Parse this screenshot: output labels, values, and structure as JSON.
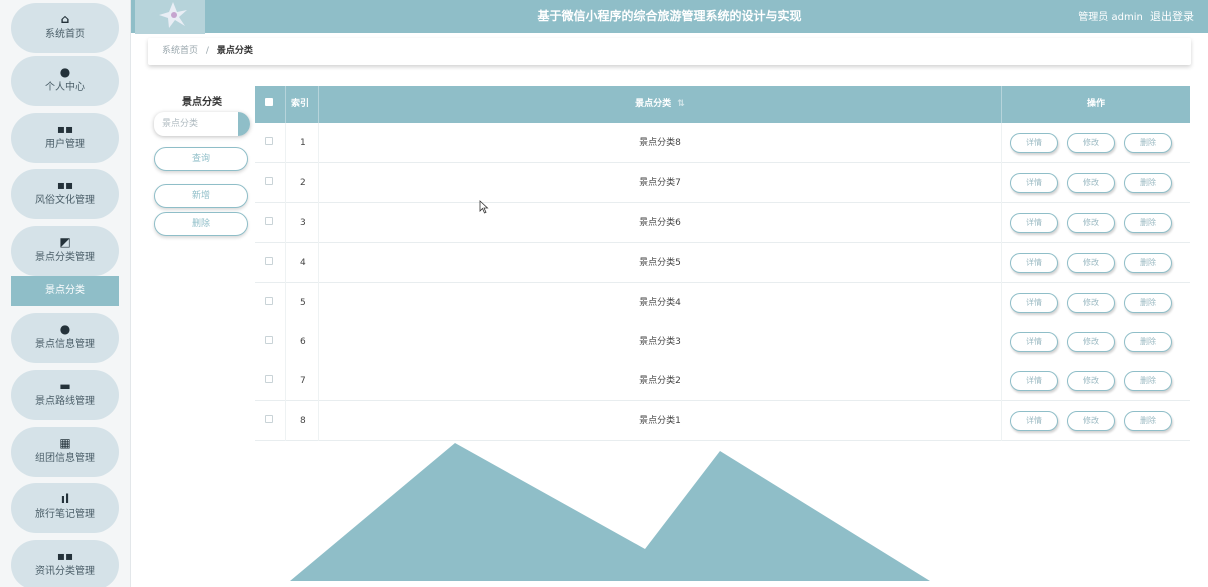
{
  "header": {
    "title": "基于微信小程序的综合旅游管理系统的设计与实现",
    "user": "管理员 admin",
    "logout": "退出登录"
  },
  "sidebar": {
    "items": [
      {
        "label": "系统首页",
        "icon": "home-icon",
        "glyph": "⌂"
      },
      {
        "label": "个人中心",
        "icon": "user-icon",
        "glyph": "●"
      },
      {
        "label": "用户管理",
        "icon": "grid-icon",
        "glyph": "▪▪"
      },
      {
        "label": "风俗文化管理",
        "icon": "grid-icon",
        "glyph": "▪▪"
      },
      {
        "label": "景点分类管理",
        "icon": "chart-icon",
        "glyph": "◩"
      },
      {
        "label": "景点信息管理",
        "icon": "user-icon",
        "glyph": "●"
      },
      {
        "label": "景点路线管理",
        "icon": "monitor-icon",
        "glyph": "▬"
      },
      {
        "label": "组团信息管理",
        "icon": "grid-icon",
        "glyph": "▦"
      },
      {
        "label": "旅行笔记管理",
        "icon": "bar-chart-icon",
        "glyph": "ıl"
      },
      {
        "label": "资讯分类管理",
        "icon": "grid-icon",
        "glyph": "▪▪"
      }
    ],
    "active_sub": "景点分类"
  },
  "breadcrumb": {
    "home": "系统首页",
    "separator": "/",
    "current": "景点分类"
  },
  "filter": {
    "label": "景点分类",
    "placeholder": "景点分类",
    "search_button": "查询",
    "add_button": "新增",
    "delete_button": "删除"
  },
  "table": {
    "columns": {
      "index": "索引",
      "category": "景点分类",
      "sort_icon": "⇅",
      "actions": "操作"
    },
    "rows": [
      {
        "index": "1",
        "category": "景点分类8"
      },
      {
        "index": "2",
        "category": "景点分类7"
      },
      {
        "index": "3",
        "category": "景点分类6"
      },
      {
        "index": "4",
        "category": "景点分类5"
      },
      {
        "index": "5",
        "category": "景点分类4"
      },
      {
        "index": "6",
        "category": "景点分类3"
      },
      {
        "index": "7",
        "category": "景点分类2"
      },
      {
        "index": "8",
        "category": "景点分类1"
      }
    ],
    "row_actions": {
      "detail": "详情",
      "edit": "修改",
      "delete": "删除"
    }
  },
  "colors": {
    "accent": "#8fbec8",
    "nav_bg": "#d5e2e8"
  }
}
